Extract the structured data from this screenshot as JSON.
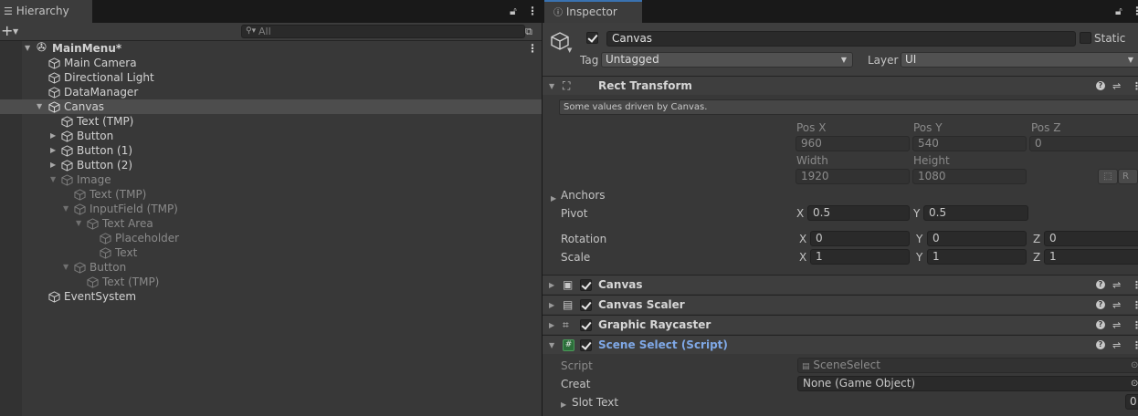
{
  "hierarchy": {
    "tab_title": "Hierarchy",
    "search_placeholder": "All",
    "scene_name": "MainMenu*",
    "rows": [
      {
        "label": "Main Camera"
      },
      {
        "label": "Directional Light"
      },
      {
        "label": "DataManager"
      },
      {
        "label": "Canvas"
      },
      {
        "label": "Text (TMP)"
      },
      {
        "label": "Button"
      },
      {
        "label": "Button (1)"
      },
      {
        "label": "Button (2)"
      },
      {
        "label": "Image"
      },
      {
        "label": "Text (TMP)"
      },
      {
        "label": "InputField (TMP)"
      },
      {
        "label": "Text Area"
      },
      {
        "label": "Placeholder"
      },
      {
        "label": "Text"
      },
      {
        "label": "Button"
      },
      {
        "label": "Text (TMP)"
      },
      {
        "label": "EventSystem"
      }
    ]
  },
  "inspector": {
    "tab_title": "Inspector",
    "object_name": "Canvas",
    "static_label": "Static",
    "tag_label": "Tag",
    "tag_value": "Untagged",
    "layer_label": "Layer",
    "layer_value": "UI",
    "rect_transform": {
      "title": "Rect Transform",
      "driven_note": "Some values driven by Canvas.",
      "pos_x_label": "Pos X",
      "pos_x": "960",
      "pos_y_label": "Pos Y",
      "pos_y": "540",
      "pos_z_label": "Pos Z",
      "pos_z": "0",
      "width_label": "Width",
      "width": "1920",
      "height_label": "Height",
      "height": "1080",
      "r_button": "R",
      "anchors_label": "Anchors",
      "pivot_label": "Pivot",
      "pivot_x": "0.5",
      "pivot_y": "0.5",
      "rotation_label": "Rotation",
      "rot_x": "0",
      "rot_y": "0",
      "rot_z": "0",
      "scale_label": "Scale",
      "scale_x": "1",
      "scale_y": "1",
      "scale_z": "1",
      "axis_x": "X",
      "axis_y": "Y",
      "axis_z": "Z"
    },
    "components": {
      "canvas": "Canvas",
      "canvas_scaler": "Canvas Scaler",
      "graphic_raycaster": "Graphic Raycaster",
      "scene_select": "Scene Select (Script)"
    },
    "scene_select": {
      "script_label": "Script",
      "script_value": "SceneSelect",
      "creat_label": "Creat",
      "creat_value": "None (Game Object)",
      "slot_text_label": "Slot Text",
      "slot_text_value": "0"
    }
  },
  "colors": {
    "panel_bg": "#383838",
    "tab_bar": "#191919",
    "selection": "#4d4d4d",
    "script_title": "#7fa8e6",
    "accent_tab": "#3a72b0"
  }
}
